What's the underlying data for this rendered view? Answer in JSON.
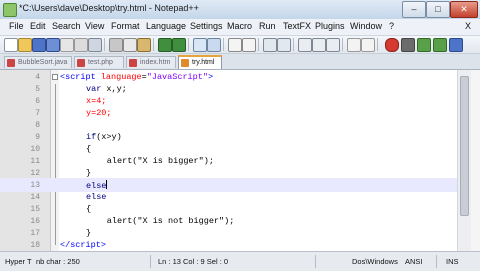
{
  "window": {
    "title": "*C:\\Users\\dave\\Desktop\\try.html - Notepad++",
    "minimize": "–",
    "maximize": "□",
    "close": "✕"
  },
  "menu": [
    "File",
    "Edit",
    "Search",
    "View",
    "Format",
    "Language",
    "Settings",
    "Macro",
    "Run",
    "TextFX",
    "Plugins",
    "Window",
    "?"
  ],
  "menu_close": "X",
  "toolbar": {
    "icons": [
      "new-file-icon",
      "open-file-icon",
      "save-icon",
      "save-all-icon",
      "close-icon",
      "close-all-icon",
      "print-icon",
      "cut-icon",
      "copy-icon",
      "paste-icon",
      "undo-icon",
      "redo-icon",
      "find-icon",
      "replace-icon",
      "zoom-in-icon",
      "zoom-out-icon",
      "sync-v-icon",
      "sync-h-icon",
      "word-wrap-icon",
      "all-chars-icon",
      "indent-guide-icon",
      "record-macro-icon",
      "stop-record-icon",
      "play-macro-icon",
      "play-multiple-icon",
      "save-macro-icon"
    ]
  },
  "tabs": [
    {
      "label": "BubbleSort.java",
      "color": "#c44"
    },
    {
      "label": "test.php",
      "color": "#c44"
    },
    {
      "label": "index.htm",
      "color": "#c44"
    },
    {
      "label": "try.html",
      "color": "#e08a2e",
      "active": true
    }
  ],
  "editor": {
    "lines": [
      {
        "n": "4",
        "tokens": [
          [
            "<",
            "tag"
          ],
          [
            "script",
            "tag"
          ],
          [
            " language",
            "attr"
          ],
          [
            "=",
            "plain"
          ],
          [
            "\"JavaScript\"",
            "str"
          ],
          [
            ">",
            "tag"
          ]
        ],
        "indent": 0,
        "fold": "box"
      },
      {
        "n": "5",
        "tokens": [
          [
            "var ",
            "kw"
          ],
          [
            "x,y;",
            "plain"
          ]
        ],
        "indent": 5
      },
      {
        "n": "6",
        "tokens": [
          [
            "x",
            "red"
          ],
          [
            "=4;",
            "red"
          ]
        ],
        "indent": 5
      },
      {
        "n": "7",
        "tokens": [
          [
            "y",
            "red"
          ],
          [
            "=20;",
            "red"
          ]
        ],
        "indent": 5
      },
      {
        "n": "8",
        "tokens": [],
        "indent": 0
      },
      {
        "n": "9",
        "tokens": [
          [
            "if",
            "kw"
          ],
          [
            "(x>y)",
            "plain"
          ]
        ],
        "indent": 5
      },
      {
        "n": "10",
        "tokens": [
          [
            "{",
            "plain"
          ]
        ],
        "indent": 5
      },
      {
        "n": "11",
        "tokens": [
          [
            "alert(",
            "plain"
          ],
          [
            "\"X is bigger\"",
            "plain"
          ],
          [
            ");",
            "plain"
          ]
        ],
        "indent": 9
      },
      {
        "n": "12",
        "tokens": [
          [
            "}",
            "plain"
          ]
        ],
        "indent": 5
      },
      {
        "n": "13",
        "tokens": [
          [
            "else",
            "kw"
          ]
        ],
        "indent": 5,
        "caret": true
      },
      {
        "n": "14",
        "tokens": [
          [
            "else",
            "kw"
          ]
        ],
        "indent": 5
      },
      {
        "n": "15",
        "tokens": [
          [
            "{",
            "plain"
          ]
        ],
        "indent": 5
      },
      {
        "n": "16",
        "tokens": [
          [
            "alert(",
            "plain"
          ],
          [
            "\"X is not bigger\"",
            "plain"
          ],
          [
            ");",
            "plain"
          ]
        ],
        "indent": 9
      },
      {
        "n": "17",
        "tokens": [
          [
            "}",
            "plain"
          ]
        ],
        "indent": 5
      },
      {
        "n": "18",
        "tokens": [
          [
            "</",
            "tag"
          ],
          [
            "script",
            "tag"
          ],
          [
            ">",
            "tag"
          ]
        ],
        "indent": 0
      }
    ]
  },
  "status": {
    "type": "Hyper T",
    "chars": "nb char : 250",
    "position": "Ln : 13   Col : 9   Sel : 0",
    "eol": "Dos\\Windows",
    "encoding": "ANSI",
    "mode": "INS"
  }
}
